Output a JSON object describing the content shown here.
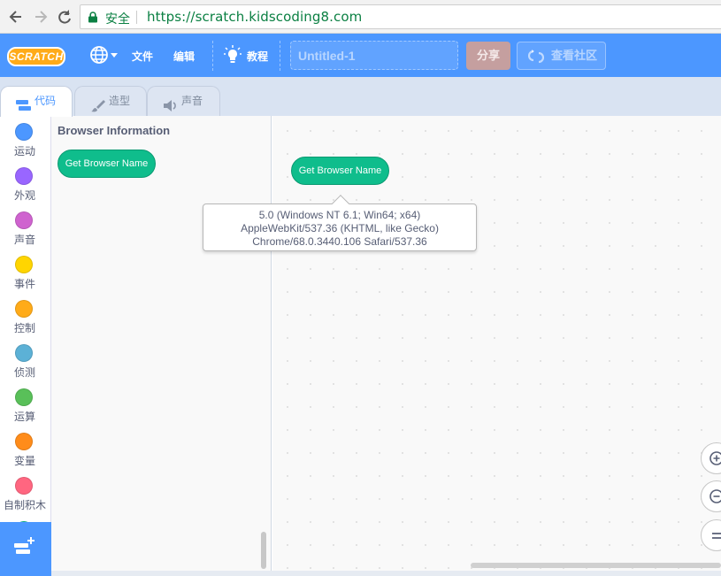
{
  "browser": {
    "secure_label": "安全",
    "url": "https://scratch.kidscoding8.com"
  },
  "menu": {
    "logo_text": "SCRATCH",
    "file_label": "文件",
    "edit_label": "编辑",
    "tutorials_label": "教程",
    "project_title": "Untitled-1",
    "share_label": "分享",
    "community_label": "查看社区"
  },
  "tabs": {
    "code": "代码",
    "costumes": "造型",
    "sounds": "声音"
  },
  "categories": [
    {
      "label": "运动",
      "color": "#4c97ff"
    },
    {
      "label": "外观",
      "color": "#9966ff"
    },
    {
      "label": "声音",
      "color": "#cf63cf"
    },
    {
      "label": "事件",
      "color": "#ffd500"
    },
    {
      "label": "控制",
      "color": "#ffab19"
    },
    {
      "label": "侦测",
      "color": "#5cb1d6"
    },
    {
      "label": "运算",
      "color": "#59c059"
    },
    {
      "label": "变量",
      "color": "#ff8c1a"
    },
    {
      "label": "自制积木",
      "color": "#ff6680"
    }
  ],
  "flyout": {
    "heading": "Browser Information",
    "block_label": "Get Browser Name"
  },
  "workspace": {
    "block_label": "Get Browser Name",
    "bubble_lines": [
      "5.0 (Windows NT 6.1; Win64; x64)",
      "AppleWebKit/537.36 (KHTML, like Gecko)",
      "Chrome/68.0.3440.106 Safari/537.36"
    ]
  },
  "icons": {
    "back": "back-arrow-icon",
    "forward": "forward-arrow-icon",
    "reload": "reload-icon",
    "lock": "lock-icon",
    "globe": "globe-icon",
    "tutorials": "lightbulb-icon",
    "community": "remix-icon",
    "code_tab": "code-blocks-icon",
    "costumes_tab": "paintbrush-icon",
    "sounds_tab": "speaker-icon",
    "extension": "add-extension-icon",
    "zoom_in": "zoom-in-icon",
    "zoom_out": "zoom-out-icon",
    "zoom_reset": "zoom-reset-icon"
  },
  "colors": {
    "menu_bar": "#4c97ff",
    "extension_block": "#0fbd8c",
    "share_button": "#c59f9f"
  }
}
